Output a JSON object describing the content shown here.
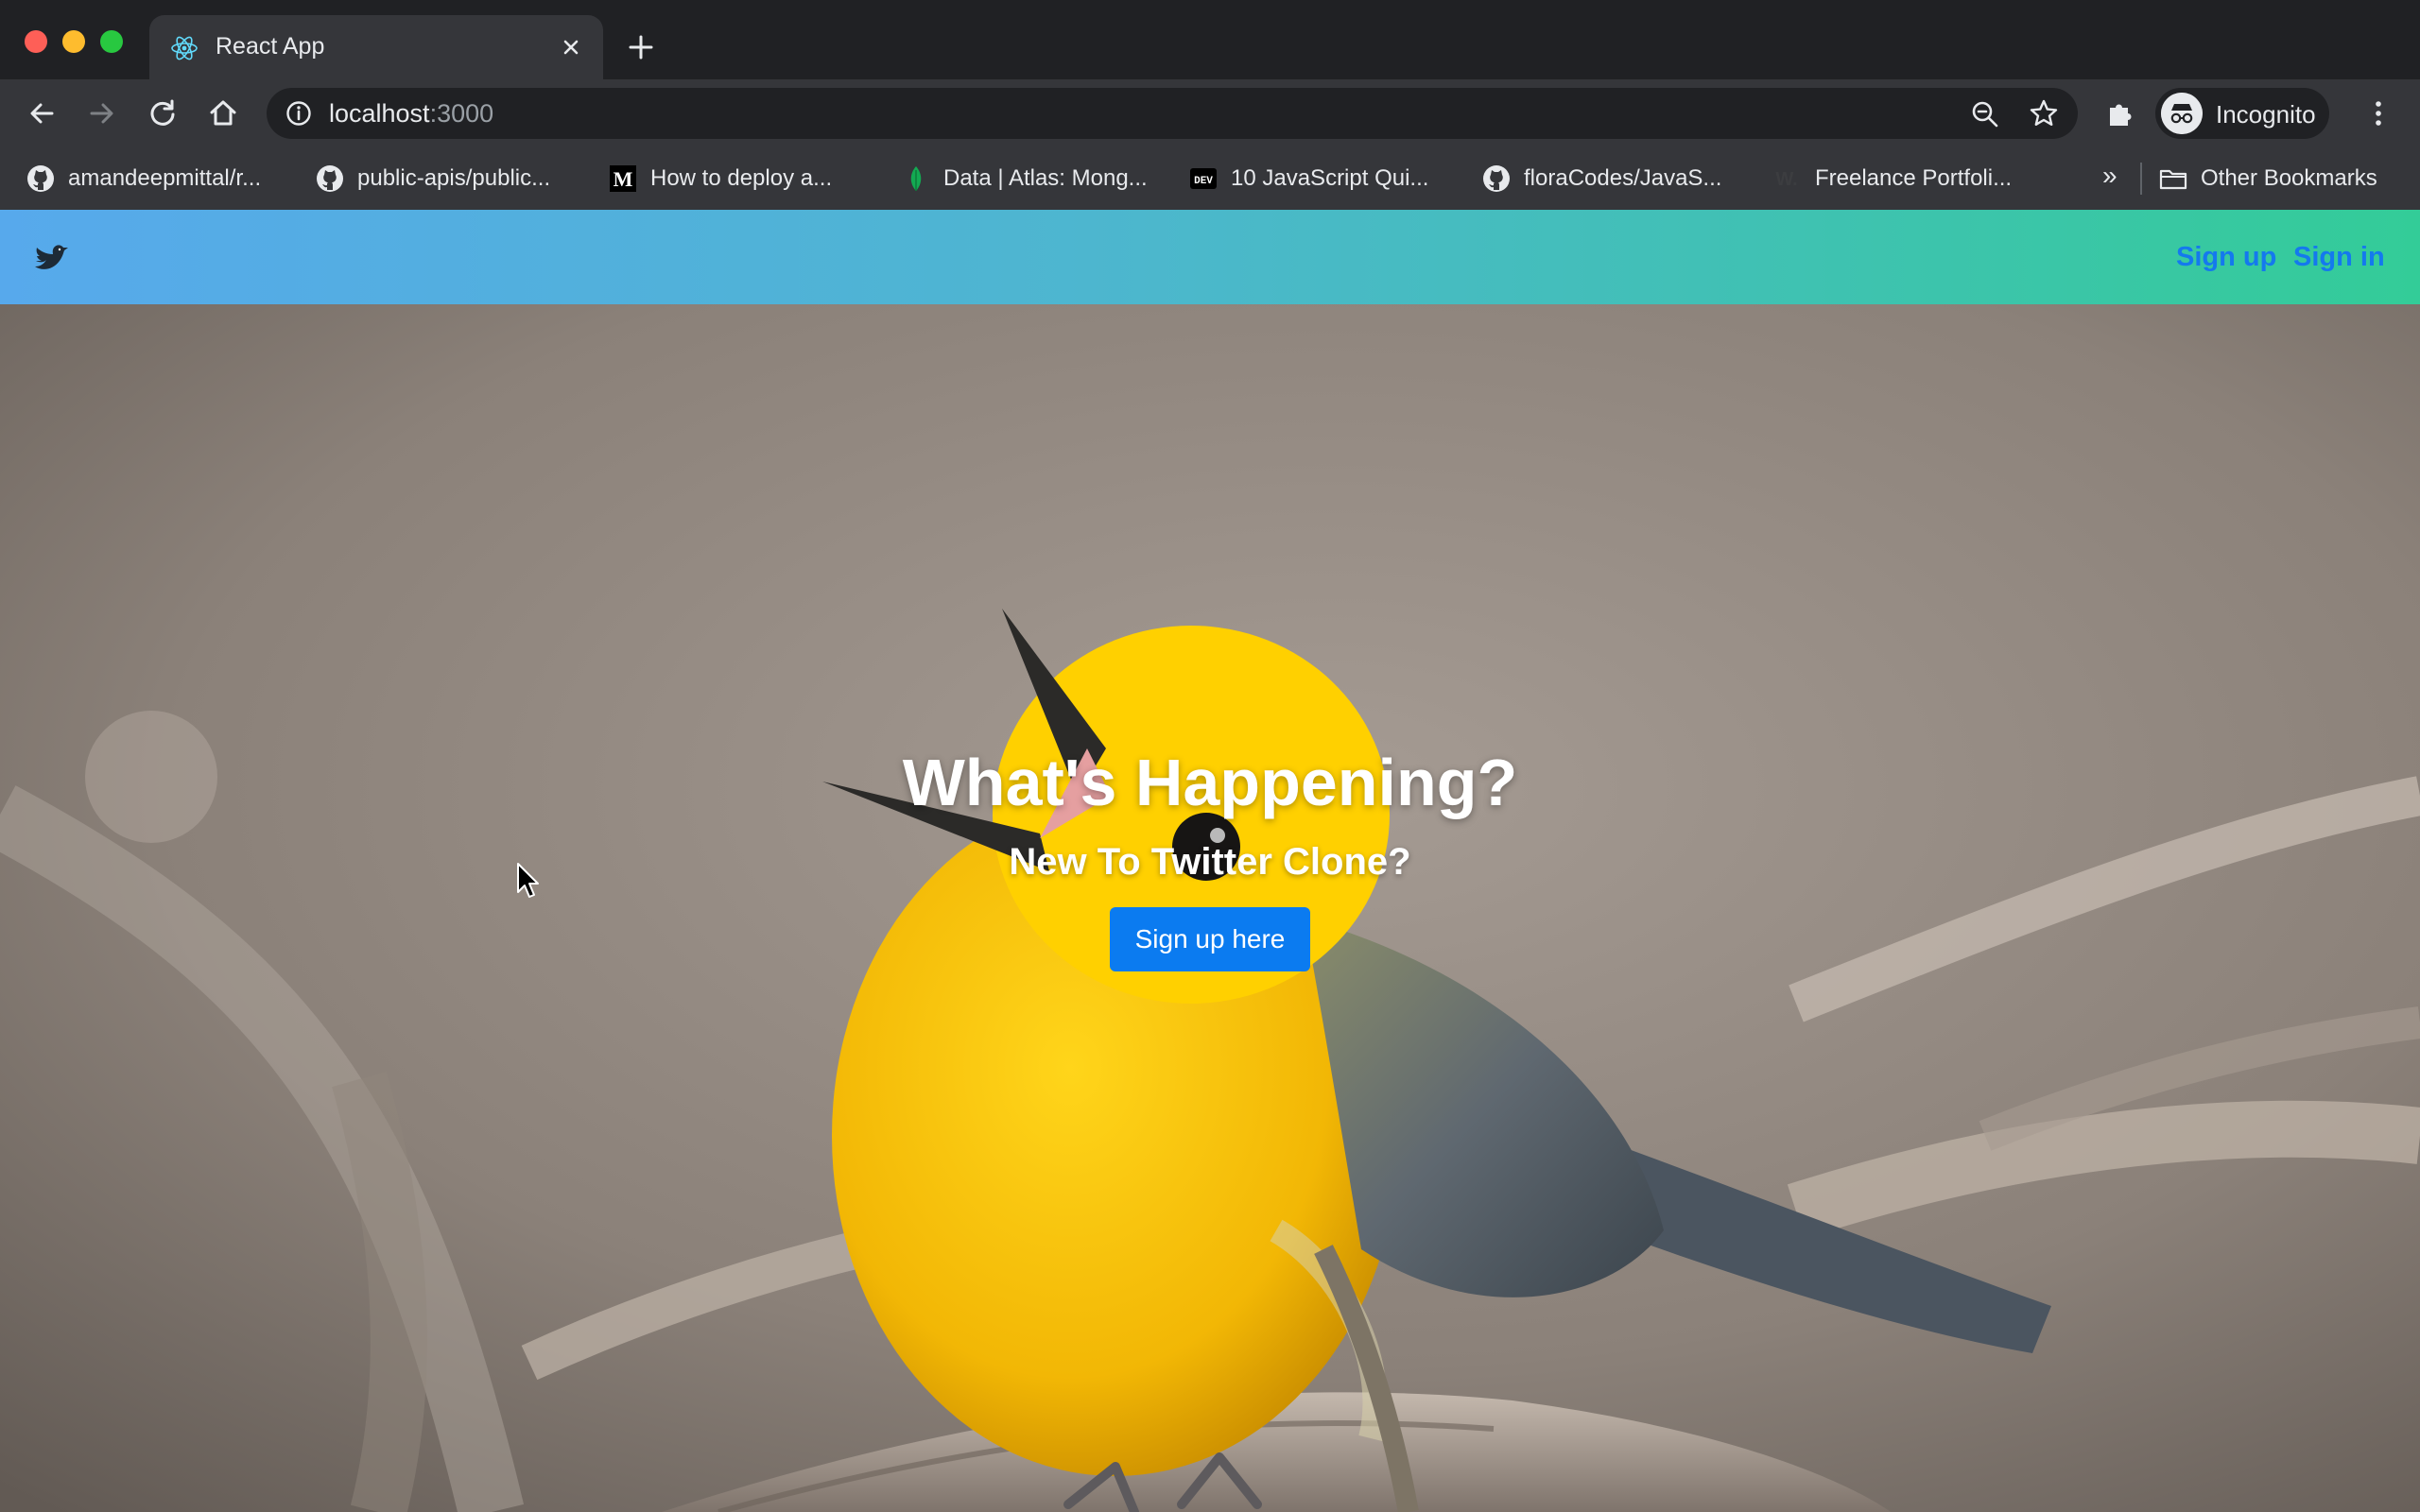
{
  "browser": {
    "tab": {
      "title": "React App",
      "favicon": "react-icon",
      "close_icon": "close-icon"
    },
    "new_tab_icon": "plus-icon",
    "toolbar": {
      "back_icon": "back-arrow-icon",
      "forward_icon": "forward-arrow-icon",
      "reload_icon": "reload-icon",
      "home_icon": "home-icon",
      "url_host": "localhost",
      "url_port": ":3000",
      "zoom_icon": "zoom-icon",
      "star_icon": "star-icon",
      "extensions_icon": "puzzle-icon",
      "profile_label": "Incognito",
      "menu_icon": "kebab-menu-icon"
    },
    "bookmarks": [
      {
        "label": "amandeepmittal/r...",
        "icon": "github-icon"
      },
      {
        "label": "public-apis/public...",
        "icon": "github-icon"
      },
      {
        "label": "How to deploy a...",
        "icon": "medium-icon"
      },
      {
        "label": "Data | Atlas: Mong...",
        "icon": "mongodb-leaf-icon"
      },
      {
        "label": "10 JavaScript Qui...",
        "icon": "dev-icon"
      },
      {
        "label": "floraCodes/JavaS...",
        "icon": "github-icon"
      },
      {
        "label": "Freelance Portfoli...",
        "icon": "w-icon"
      }
    ],
    "bookmarks_overflow": "»",
    "other_bookmarks": "Other Bookmarks"
  },
  "page": {
    "brand_icon": "bird-icon",
    "nav": {
      "signup": "Sign up",
      "signin": "Sign in"
    },
    "hero": {
      "title": "What's Happening?",
      "subtitle": "New To Twitter Clone?",
      "button": "Sign up here"
    },
    "colors": {
      "navbar_gradient_start": "#57a9ec",
      "navbar_gradient_end": "#33cc98",
      "link_blue": "#1479ee",
      "button_blue": "#0b7bf0"
    }
  }
}
